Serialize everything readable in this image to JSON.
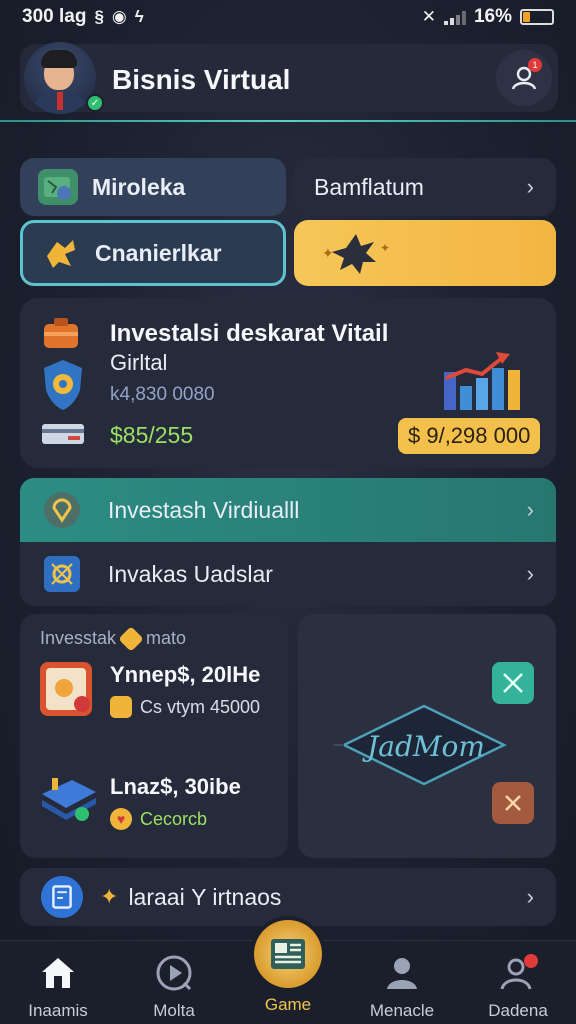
{
  "status_bar": {
    "time": "300 lag",
    "left_icons": [
      "s-icon",
      "record-icon",
      "bolt-icon"
    ],
    "battery": "16%",
    "battery_level": 0.3,
    "signal_icon": "signal-bars-icon",
    "wifi_icon": "wifi-off-icon"
  },
  "header": {
    "title": "Bisnis Virtual",
    "profile_icon": "user-icon",
    "notification_count": "1"
  },
  "tiles": {
    "top_left": {
      "label": "Miroleka",
      "icon": "map-icon"
    },
    "top_right": {
      "label": "Bamflatum"
    },
    "mid_left": {
      "label": "Cnanierlkar",
      "icon": "puzzle-icon"
    },
    "mid_right": {
      "icon": "burst-star-icon"
    }
  },
  "investment_card": {
    "title": "Investalsi deskarat Vitail",
    "title_line2": "Girltal",
    "sub_value": "k4,830 0080",
    "value_green": "$85/255",
    "value_badge": "$ 9/,298 000",
    "icons": [
      "briefcase-icon",
      "shield-gear-icon",
      "card-icon",
      "growth-chart-icon"
    ]
  },
  "list": [
    {
      "label": "Investash Virdiualll",
      "icon": "location-pin-icon",
      "highlight": true
    },
    {
      "label": "Invakas Uadslar",
      "icon": "gear-box-icon",
      "highlight": false
    }
  ],
  "left_panel": {
    "heading": "Invesstak",
    "heading_tag": "mato",
    "items": [
      {
        "title": "Ynnep$, 20lHe",
        "sub": "Cs vtym 45000",
        "icon": "document-icon",
        "sub_icon": "gold-coin-icon"
      },
      {
        "title": "Lnaz$, 30ibe",
        "sub": "Cecorcb",
        "icon": "blue-stack-icon",
        "sub_icon": "heart-coin-icon"
      }
    ]
  },
  "right_panel": {
    "logo_text": "JadMom",
    "accept_icon": "crossed-arrows-icon",
    "reject_icon": "close-icon"
  },
  "footer_row": {
    "label": "larаaі Y irtnaos",
    "icon": "document-bookmark-icon"
  },
  "nav": {
    "items": [
      {
        "label": "Inaamis",
        "icon": "home-icon"
      },
      {
        "label": "Molta",
        "icon": "play-circle-icon"
      },
      {
        "label": "Game",
        "icon": "newspaper-icon"
      },
      {
        "label": "Menacle",
        "icon": "person-icon"
      },
      {
        "label": "Dadena",
        "icon": "user-alert-icon"
      }
    ]
  },
  "colors": {
    "accent_teal": "#2a8f84",
    "accent_gold": "#f4c04c",
    "green_value": "#9be063",
    "card_bg": "#262b3b"
  }
}
